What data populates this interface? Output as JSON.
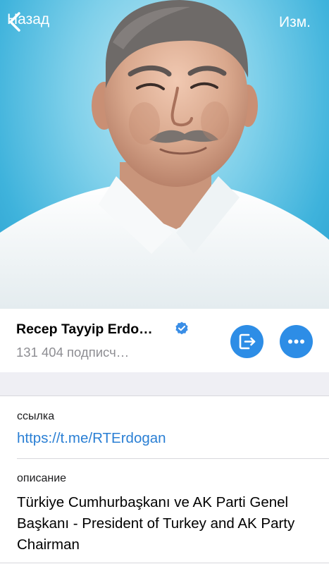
{
  "nav": {
    "back_label": "Назад",
    "edit_label": "Изм."
  },
  "header_photo": {
    "description": "portrait-photo",
    "background_color": "#5cc3e6"
  },
  "channel": {
    "name": "Recep Tayyip Erdo…",
    "subscribers": "131 404 подписч…",
    "verified": true
  },
  "actions": {
    "leave_icon": "leave-icon",
    "more_icon": "more-icon",
    "accent_color": "#2d8de6"
  },
  "info": {
    "link_label": "ссылка",
    "link_value": "https://t.me/RTErdogan",
    "description_label": "описание",
    "description_value": "Türkiye Cumhurbaşkanı ve AK Parti Genel Başkanı - President of Turkey and AK Party Chairman"
  }
}
